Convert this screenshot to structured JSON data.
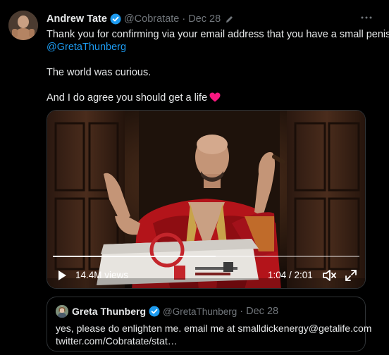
{
  "tweet": {
    "author_name": "Andrew Tate",
    "handle": "@Cobratate",
    "separator": "·",
    "date": "Dec 28",
    "text_line1": "Thank you for confirming via your email address that you have a small penis",
    "mention": "@GretaThunberg",
    "text_line2": "The world was curious.",
    "text_line3": "And I do agree you should get a life",
    "icons": {
      "verified": "verified-badge-icon",
      "edit": "pencil-icon",
      "more": "more-icon",
      "heart": "red-heart-emoji"
    }
  },
  "video": {
    "views": "14.4M views",
    "timecode": "1:04 / 2:01",
    "progress": 0.53,
    "icons": {
      "play": "play-icon",
      "volume": "volume-icon",
      "fullscreen": "fullscreen-icon"
    }
  },
  "quote": {
    "author_name": "Greta Thunberg",
    "handle": "@GretaThunberg",
    "separator": "·",
    "date": "Dec 28",
    "text_line1": "yes, please do enlighten me. email me at smalldickenergy@getalife.com",
    "text_line2": "twitter.com/Cobratate/stat…"
  },
  "colors": {
    "background": "#000000",
    "text": "#e7e9ea",
    "muted": "#71767b",
    "link": "#1d9bf0",
    "border": "#2f3336",
    "heart": "#f91880"
  }
}
